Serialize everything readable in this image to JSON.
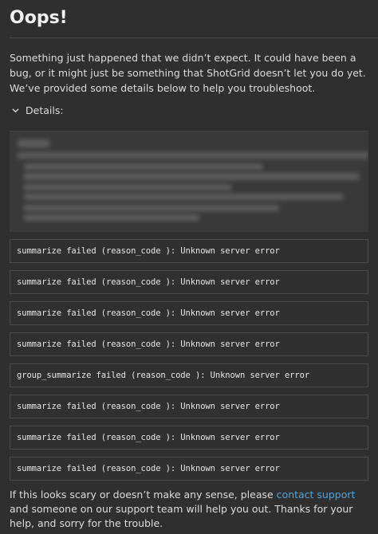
{
  "dialog": {
    "title": "Oops!",
    "intro": "Something just happened that we didn’t expect. It could have been a bug, or it might just be something that ShotGrid doesn’t let you do yet. We’ve provided some details below to help you troubleshoot.",
    "details_label": "Details:",
    "details_icon": "chevron-down-icon",
    "details_content_obscured": true,
    "errors": [
      "summarize failed (reason_code ): Unknown server error",
      "summarize failed (reason_code ): Unknown server error",
      "summarize failed (reason_code ): Unknown server error",
      "summarize failed (reason_code ): Unknown server error",
      "group_summarize failed (reason_code ): Unknown server error",
      "summarize failed (reason_code ): Unknown server error",
      "summarize failed (reason_code ): Unknown server error",
      "summarize failed (reason_code ): Unknown server error"
    ],
    "footer": {
      "before_link": "If this looks scary or doesn’t make any sense, please ",
      "link_text": "contact support",
      "after_link": " and someone on our support team will help you out. Thanks for your help, and sorry for the trouble."
    },
    "colors": {
      "background": "#2f2f2f",
      "link": "#4ea3e0",
      "text": "#dcdcdc"
    }
  }
}
